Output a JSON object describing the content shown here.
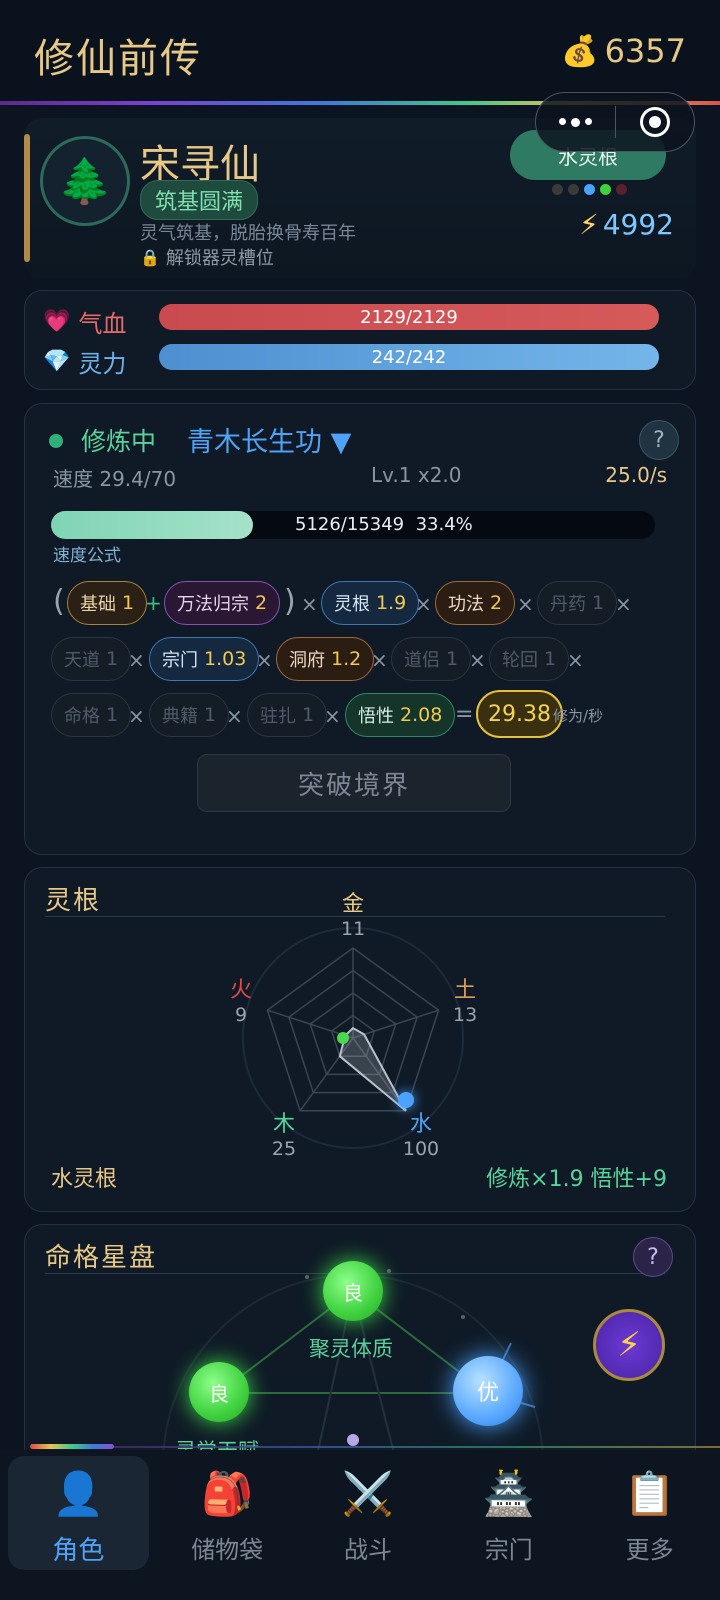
{
  "header": {
    "title": "修仙前传",
    "coins": "6357",
    "coin_icon": "money-bag-icon"
  },
  "capsule": {
    "menu_icon": "more-dots-icon",
    "close_icon": "target-circle-icon"
  },
  "profile": {
    "name": "宋寻仙",
    "avatar_icon": "pine-tree-icon",
    "realm": "筑基圆满",
    "realm_desc": "灵气筑基，脱胎换骨寿百年",
    "unlock_text": "解锁器灵槽位",
    "root_tag": "水灵根",
    "root_dot_colors": [
      "#3a3a3a",
      "#3a3a3a",
      "#4aa3ff",
      "#3fd13f",
      "#5a2030"
    ],
    "power": "4992"
  },
  "vitals": {
    "hp_label": "气血",
    "hp_text": "2129/2129",
    "hp_fraction": 1.0,
    "mp_label": "灵力",
    "mp_text": "242/242",
    "mp_fraction": 1.0
  },
  "cultivation": {
    "status": "修炼中",
    "technique": "青木长生功 ▼",
    "help": "?",
    "speed": "速度 29.4/70",
    "level": "Lv.1 x2.0",
    "rate": "25.0/s",
    "progress_text": "5126/15349  33.4%",
    "progress_fraction": 0.334,
    "formula_label": "速度公式",
    "factors": [
      {
        "label": "基础",
        "value": "1"
      },
      {
        "label": "万法归宗",
        "value": "2"
      },
      {
        "label": "灵根",
        "value": "1.9"
      },
      {
        "label": "功法",
        "value": "2"
      },
      {
        "label": "丹药",
        "value": "1"
      },
      {
        "label": "天道",
        "value": "1"
      },
      {
        "label": "宗门",
        "value": "1.03"
      },
      {
        "label": "洞府",
        "value": "1.2"
      },
      {
        "label": "道侣",
        "value": "1"
      },
      {
        "label": "轮回",
        "value": "1"
      },
      {
        "label": "命格",
        "value": "1"
      },
      {
        "label": "典籍",
        "value": "1"
      },
      {
        "label": "驻扎",
        "value": "1"
      },
      {
        "label": "悟性",
        "value": "2.08"
      }
    ],
    "result": "29.38",
    "unit": "修为/秒",
    "breakthrough": "突破境界"
  },
  "spirit_root": {
    "title": "灵根",
    "elements": [
      {
        "name": "金",
        "value": "11",
        "color": "#e8c887"
      },
      {
        "name": "土",
        "value": "13",
        "color": "#d9a05b"
      },
      {
        "name": "水",
        "value": "100",
        "color": "#4fa3f7"
      },
      {
        "name": "木",
        "value": "25",
        "color": "#58d39a"
      },
      {
        "name": "火",
        "value": "9",
        "color": "#e04a4a"
      }
    ],
    "root_name": "水灵根",
    "bonus": "修炼×1.9  悟性+9"
  },
  "destiny": {
    "title": "命格星盘",
    "help": "?",
    "nodes": [
      {
        "grade": "良",
        "label": "聚灵体质"
      },
      {
        "grade": "良",
        "label": "灵觉天赋"
      },
      {
        "grade": "优",
        "label": ""
      }
    ]
  },
  "nav": [
    {
      "label": "角色",
      "icon": "person-icon"
    },
    {
      "label": "储物袋",
      "icon": "backpack-icon"
    },
    {
      "label": "战斗",
      "icon": "crossed-swords-icon"
    },
    {
      "label": "宗门",
      "icon": "castle-icon"
    },
    {
      "label": "更多",
      "icon": "clipboard-icon"
    }
  ]
}
